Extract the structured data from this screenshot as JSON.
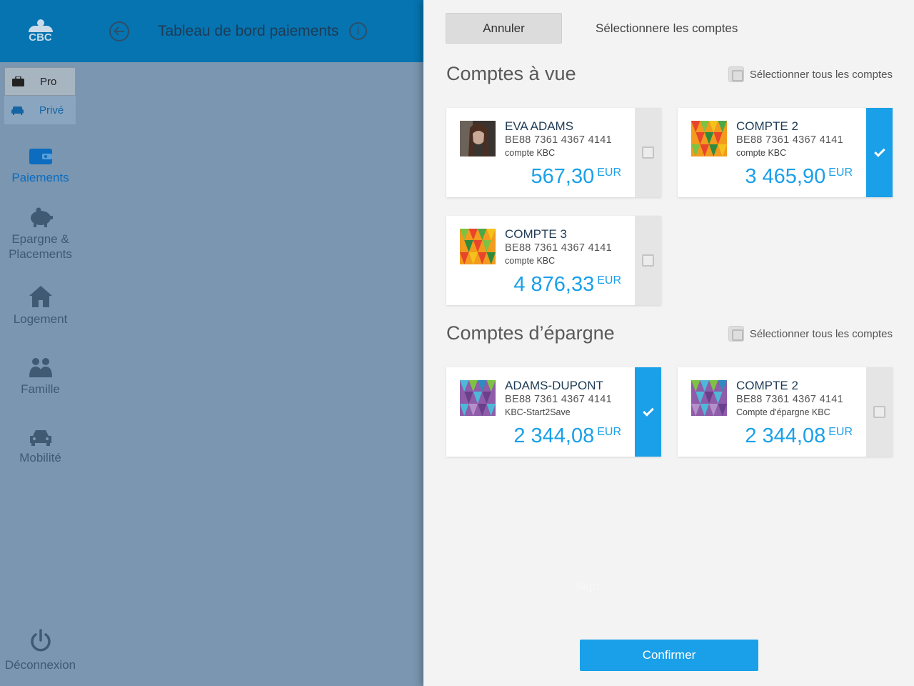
{
  "brand": {
    "logo_text": "CBC"
  },
  "profiles": {
    "pro_label": "Pro",
    "prive_label": "Privé"
  },
  "nav": {
    "payments": "Paiements",
    "savings_line1": "Epargne &",
    "savings_line2": "Placements",
    "housing": "Logement",
    "family": "Famille",
    "mobility": "Mobilité",
    "logout": "Déconnexion"
  },
  "header": {
    "title": "Tableau de bord paiements",
    "info_icon": "i"
  },
  "panel": {
    "cancel_label": "Annuler",
    "title": "Sélectionnere les comptes",
    "sign_text": "Sign",
    "confirm_label": "Confirmer"
  },
  "sections": [
    {
      "title": "Comptes à vue",
      "select_all": "Sélectionner tous les comptes",
      "accounts": [
        {
          "name": "EVA ADAMS",
          "iban": "BE88 7361 4367 4141",
          "type": "compte KBC",
          "amount": "567,30",
          "currency": "EUR",
          "selected": false,
          "thumb": "photo"
        },
        {
          "name": "COMPTE 2",
          "iban": "BE88 7361 4367 4141",
          "type": "compte KBC",
          "amount": "3 465,90",
          "currency": "EUR",
          "selected": true,
          "thumb": "triangles-warm"
        },
        {
          "name": "COMPTE 3",
          "iban": "BE88 7361 4367 4141",
          "type": "compte KBC",
          "amount": "4 876,33",
          "currency": "EUR",
          "selected": false,
          "thumb": "triangles-warm"
        }
      ]
    },
    {
      "title": "Comptes d’épargne",
      "select_all": "Sélectionner tous les comptes",
      "accounts": [
        {
          "name": "ADAMS-DUPONT",
          "iban": "BE88 7361 4367 4141",
          "type": "KBC-Start2Save",
          "amount": "2 344,08",
          "currency": "EUR",
          "selected": true,
          "thumb": "triangles-cool"
        },
        {
          "name": "COMPTE 2",
          "iban": "BE88 7361 4367 4141",
          "type": "Compte d'épargne KBC",
          "amount": "2 344,08",
          "currency": "EUR",
          "selected": false,
          "thumb": "triangles-cool"
        }
      ]
    }
  ],
  "colors": {
    "accent": "#1aa0e8",
    "header_blue": "#0674b0",
    "overlay": "#7a96b0"
  }
}
